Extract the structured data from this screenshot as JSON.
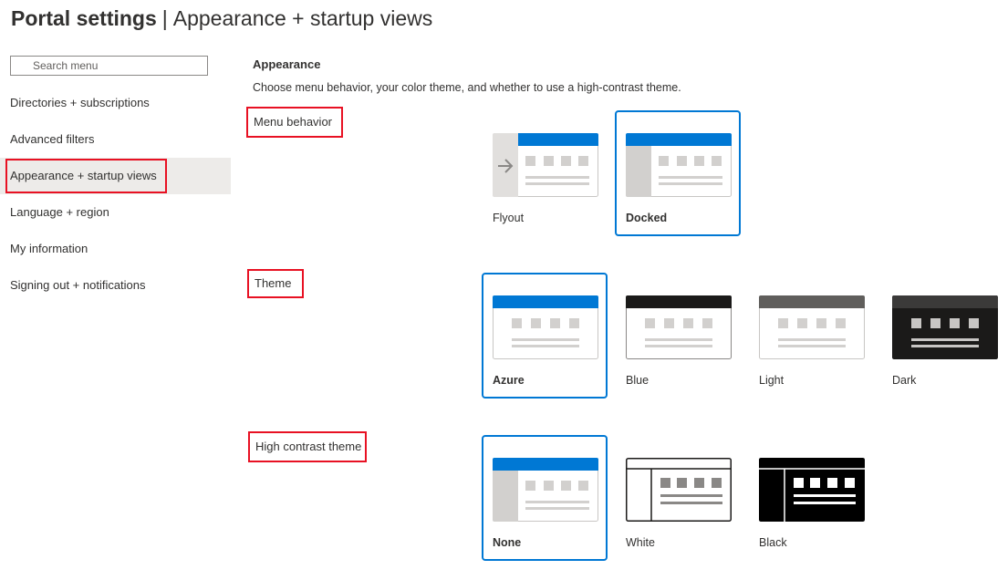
{
  "page": {
    "title_main": "Portal settings",
    "title_separator": "|",
    "title_sub": "Appearance + startup views"
  },
  "search": {
    "placeholder": "Search menu"
  },
  "nav": {
    "items": [
      {
        "label": "Directories + subscriptions",
        "selected": false
      },
      {
        "label": "Advanced filters",
        "selected": false
      },
      {
        "label": "Appearance + startup views",
        "selected": true
      },
      {
        "label": "Language + region",
        "selected": false
      },
      {
        "label": "My information",
        "selected": false
      },
      {
        "label": "Signing out + notifications",
        "selected": false
      }
    ]
  },
  "appearance": {
    "title": "Appearance",
    "description": "Choose menu behavior, your color theme, and whether to use a high-contrast theme.",
    "menu_behavior": {
      "label": "Menu behavior",
      "options": [
        {
          "label": "Flyout",
          "selected": false
        },
        {
          "label": "Docked",
          "selected": true
        }
      ]
    },
    "theme": {
      "label": "Theme",
      "options": [
        {
          "label": "Azure",
          "selected": true
        },
        {
          "label": "Blue",
          "selected": false
        },
        {
          "label": "Light",
          "selected": false
        },
        {
          "label": "Dark",
          "selected": false
        }
      ]
    },
    "high_contrast": {
      "label": "High contrast theme",
      "options": [
        {
          "label": "None",
          "selected": true
        },
        {
          "label": "White",
          "selected": false
        },
        {
          "label": "Black",
          "selected": false
        }
      ]
    }
  },
  "colors": {
    "accent": "#0078d4",
    "highlight": "#e81123",
    "nav_selected_bg": "#edebe9"
  }
}
